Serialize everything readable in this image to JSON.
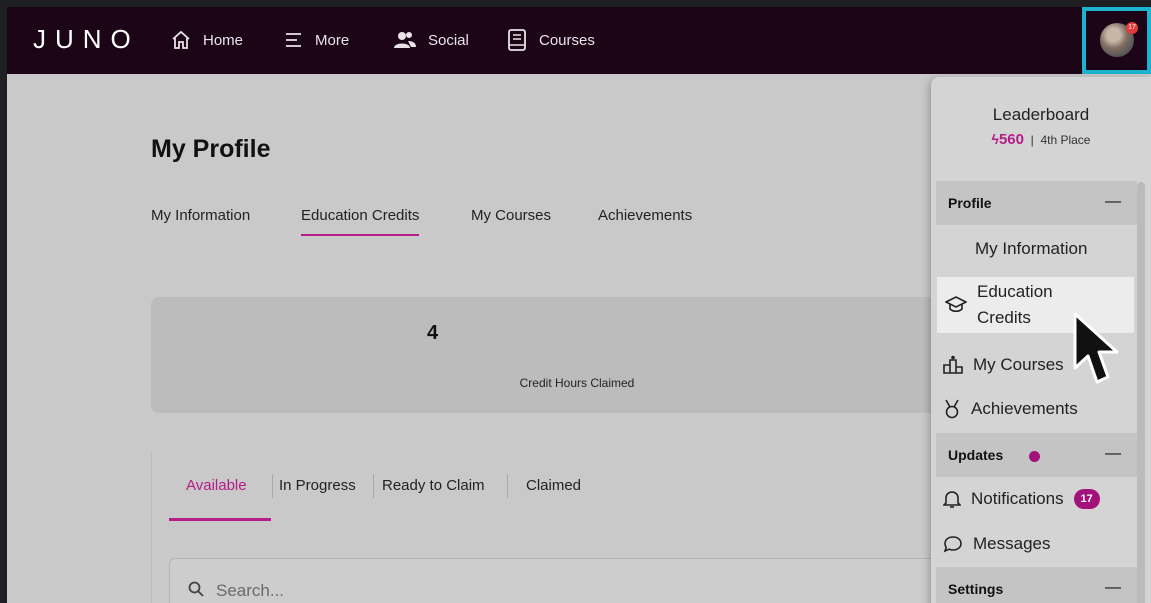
{
  "topbar": {
    "logo": "JUNO",
    "nav": [
      {
        "label": "Home",
        "icon": "home-icon"
      },
      {
        "label": "More",
        "icon": "menu-icon"
      },
      {
        "label": "Social",
        "icon": "people-icon"
      },
      {
        "label": "Courses",
        "icon": "book-icon"
      }
    ],
    "avatar_badge": "17"
  },
  "main": {
    "title": "My Profile",
    "tabs": [
      "My Information",
      "Education Credits",
      "My Courses",
      "Achievements"
    ],
    "active_tab": "Education Credits",
    "credits": {
      "value": "4",
      "label": "Credit Hours Claimed"
    },
    "subtabs": [
      "Available",
      "In Progress",
      "Ready to Claim",
      "Claimed"
    ],
    "active_subtab": "Available",
    "search": {
      "placeholder": "Search..."
    }
  },
  "dropdown": {
    "leaderboard": {
      "title": "Leaderboard",
      "points": "560",
      "separator": "|",
      "place": "4th Place"
    },
    "profile_group": {
      "label": "Profile",
      "toggle": "—"
    },
    "profile_items": [
      "My Information",
      "Education Credits",
      "My Courses",
      "Achievements"
    ],
    "updates_group": {
      "label": "Updates",
      "toggle": "—"
    },
    "notifications": {
      "label": "Notifications",
      "count": "17"
    },
    "messages": {
      "label": "Messages"
    },
    "settings_group": {
      "label": "Settings",
      "toggle": "—"
    }
  },
  "colors": {
    "accent": "#b51d8a",
    "topbar": "#1d0518",
    "highlight_border": "#1ab4d1"
  }
}
